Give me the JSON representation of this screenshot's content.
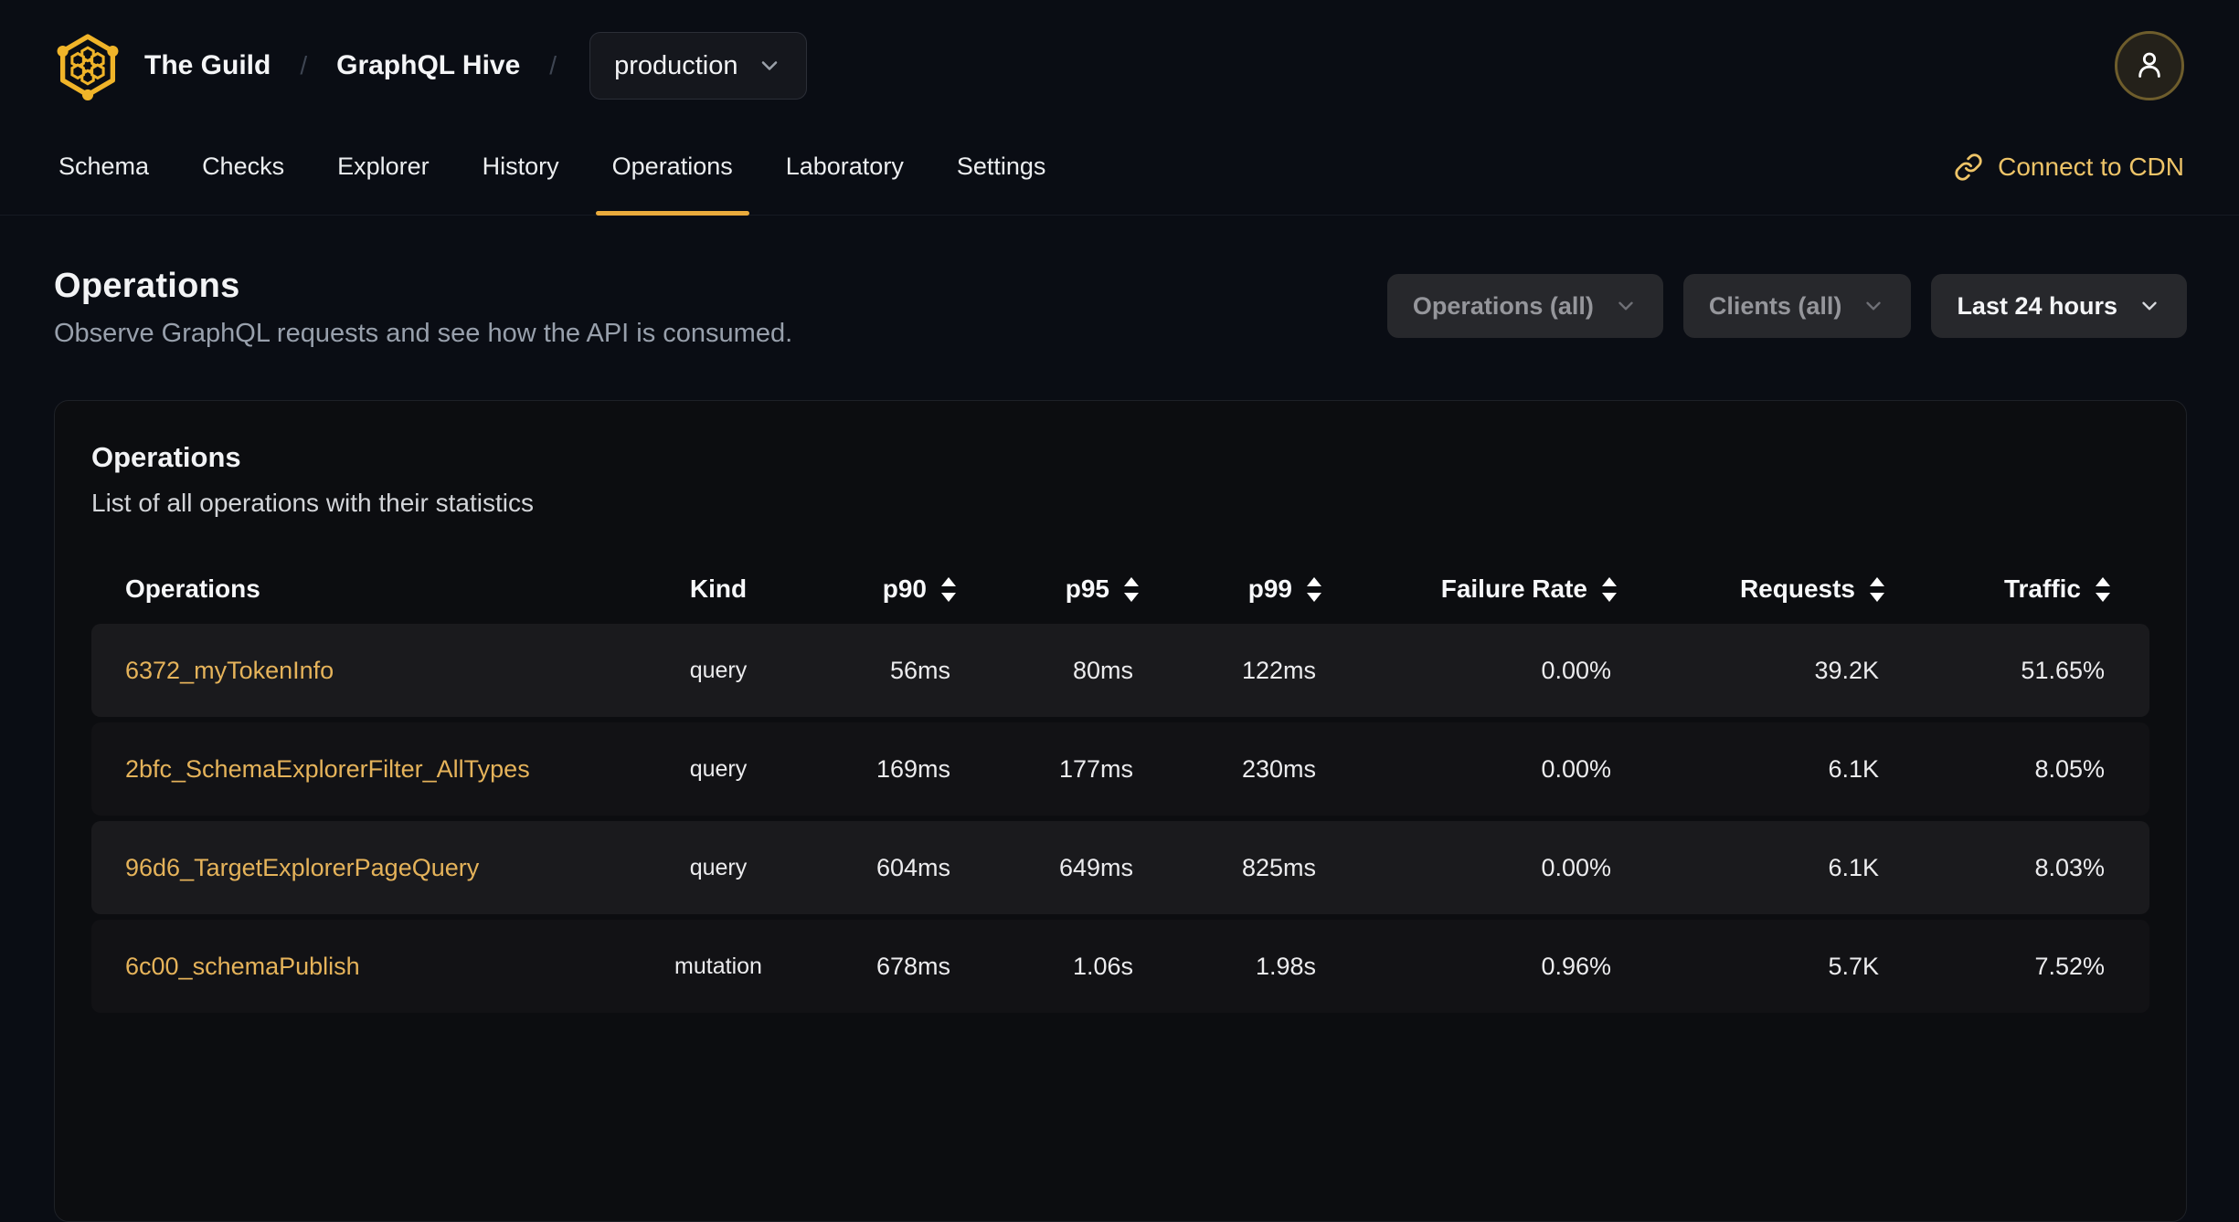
{
  "header": {
    "org": "The Guild",
    "project": "GraphQL Hive",
    "separator": "/",
    "target": "production"
  },
  "nav": {
    "tabs": [
      {
        "label": "Schema",
        "active": false
      },
      {
        "label": "Checks",
        "active": false
      },
      {
        "label": "Explorer",
        "active": false
      },
      {
        "label": "History",
        "active": false
      },
      {
        "label": "Operations",
        "active": true
      },
      {
        "label": "Laboratory",
        "active": false
      },
      {
        "label": "Settings",
        "active": false
      }
    ],
    "cdn_label": "Connect to CDN"
  },
  "page": {
    "title": "Operations",
    "subtitle": "Observe GraphQL requests and see how the API is consumed."
  },
  "filters": {
    "operations": "Operations (all)",
    "clients": "Clients (all)",
    "period": "Last 24 hours"
  },
  "card": {
    "title": "Operations",
    "subtitle": "List of all operations with their statistics"
  },
  "table": {
    "columns": [
      "Operations",
      "Kind",
      "p90",
      "p95",
      "p99",
      "Failure Rate",
      "Requests",
      "Traffic"
    ],
    "rows": [
      {
        "name": "6372_myTokenInfo",
        "kind": "query",
        "p90": "56ms",
        "p95": "80ms",
        "p99": "122ms",
        "failure_rate": "0.00%",
        "requests": "39.2K",
        "traffic": "51.65%"
      },
      {
        "name": "2bfc_SchemaExplorerFilter_AllTypes",
        "kind": "query",
        "p90": "169ms",
        "p95": "177ms",
        "p99": "230ms",
        "failure_rate": "0.00%",
        "requests": "6.1K",
        "traffic": "8.05%"
      },
      {
        "name": "96d6_TargetExplorerPageQuery",
        "kind": "query",
        "p90": "604ms",
        "p95": "649ms",
        "p99": "825ms",
        "failure_rate": "0.00%",
        "requests": "6.1K",
        "traffic": "8.03%"
      },
      {
        "name": "6c00_schemaPublish",
        "kind": "mutation",
        "p90": "678ms",
        "p95": "1.06s",
        "p99": "1.98s",
        "failure_rate": "0.96%",
        "requests": "5.7K",
        "traffic": "7.52%"
      }
    ]
  },
  "icons": {
    "logo": "hive-logo",
    "target_chevron": "chevron-down-icon",
    "user": "user-icon",
    "cdn": "link-icon",
    "sort": "sort-arrows-icon"
  },
  "colors": {
    "accent_underline": "#eaab3c",
    "link_gold": "#e5b35a",
    "cdn_gold": "#eec468",
    "page_bg": "#0a0d14",
    "card_bg": "#0c0d10",
    "row_odd": "#1a1a1d",
    "row_even": "#121215"
  }
}
